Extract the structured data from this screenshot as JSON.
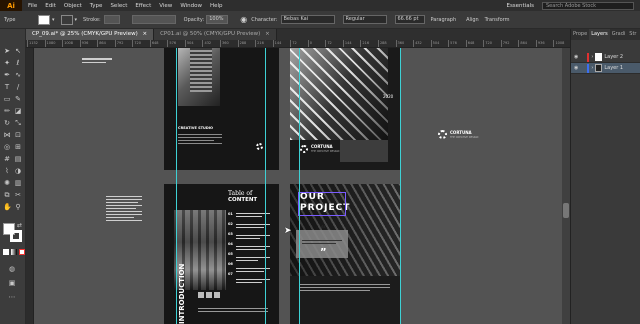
{
  "menubar": {
    "app_logo": "Ai",
    "items": [
      "File",
      "Edit",
      "Object",
      "Type",
      "Select",
      "Effect",
      "View",
      "Window",
      "Help"
    ],
    "workspace": "Essentials",
    "search_placeholder": "Search Adobe Stock"
  },
  "controlbar": {
    "selection_label": "Type",
    "stroke_label": "Stroke:",
    "opacity_label": "Opacity:",
    "opacity_value": "100%",
    "character_label": "Character:",
    "font_family": "Bebas Kai",
    "font_style": "Regular",
    "font_size": "66.66 pt",
    "paragraph_label": "Paragraph",
    "align_label": "Align",
    "transform_label": "Transform"
  },
  "tabs": [
    {
      "label": "CP_09.ai* @ 25% (CMYK/GPU Preview)",
      "close": "×"
    },
    {
      "label": "CP01.ai @ 50% (CMYK/GPU Preview)",
      "close": "×"
    }
  ],
  "ruler_marks": [
    "1152",
    "1080",
    "1008",
    "936",
    "864",
    "792",
    "720",
    "648",
    "576",
    "504",
    "432",
    "360",
    "288",
    "216",
    "144",
    "72",
    "0",
    "72",
    "144",
    "216",
    "288",
    "360",
    "432",
    "504",
    "576",
    "648",
    "720",
    "792",
    "864",
    "936",
    "1008"
  ],
  "panel": {
    "tabs": [
      "Prope",
      "Layers",
      "Gradi",
      "Str"
    ],
    "layers": [
      {
        "name": "Layer 2",
        "color": "#e03030",
        "selected": false
      },
      {
        "name": "Layer 1",
        "color": "#3c6ff0",
        "selected": true
      }
    ]
  },
  "artboards": {
    "cover": {
      "brand": "CORTUNA",
      "tagline": "THE CREATIVE DESIGN",
      "title": "CREATIVE STUDIO",
      "year": "2020"
    },
    "side_logo": {
      "brand": "CORTUNA",
      "tagline": "THE CREATIVE DESIGN"
    },
    "toc": {
      "title_line1": "Table of",
      "title_line2": "CONTENT",
      "vertical_text": "INTRODUCTION",
      "items": [
        "01",
        "02",
        "03",
        "04",
        "05",
        "06",
        "07"
      ]
    },
    "project": {
      "title_line1": "OUR",
      "title_line2": "PROJECT",
      "open_quote": "“",
      "close_quote": "”"
    }
  },
  "colors": {
    "accent": "#ff9a00",
    "guide": "#3ed1d5",
    "selection": "#7a5cff"
  }
}
